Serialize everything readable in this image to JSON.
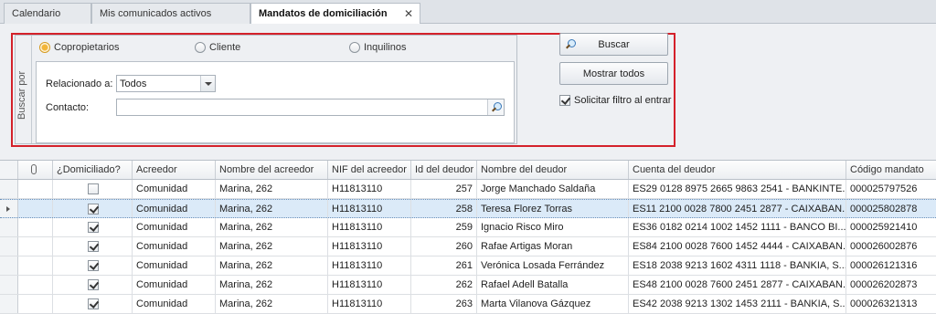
{
  "tabs": [
    {
      "label": "Calendario",
      "active": false
    },
    {
      "label": "Mis comunicados activos",
      "active": false
    },
    {
      "label": "Mandatos de domiciliación",
      "active": true
    }
  ],
  "filter": {
    "group_label": "Buscar por",
    "radios": [
      {
        "label": "Copropietarios",
        "checked": true
      },
      {
        "label": "Cliente",
        "checked": false
      },
      {
        "label": "Inquilinos",
        "checked": false
      }
    ],
    "related_label": "Relacionado a:",
    "related_value": "Todos",
    "contact_label": "Contacto:",
    "contact_value": ""
  },
  "actions": {
    "search_label": "Buscar",
    "show_all_label": "Mostrar todos",
    "filter_on_enter_label": "Solicitar filtro al entrar",
    "filter_on_enter_checked": true
  },
  "grid": {
    "columns": [
      "¿Domiciliado?",
      "Acreedor",
      "Nombre del acreedor",
      "NIF del acreedor",
      "Id del deudor",
      "Nombre del deudor",
      "Cuenta del deudor",
      "Código mandato"
    ],
    "selected_row": 1,
    "rows": [
      {
        "domiciliado": false,
        "acreedor": "Comunidad",
        "nombre_acreedor": "Marina, 262",
        "nif": "H11813110",
        "id_deudor": "257",
        "nombre_deudor": "Jorge Manchado Saldaña",
        "cuenta": "ES29 0128 8975 2665 9863 2541 - BANKINTE...",
        "codigo": "000025797526"
      },
      {
        "domiciliado": true,
        "acreedor": "Comunidad",
        "nombre_acreedor": "Marina, 262",
        "nif": "H11813110",
        "id_deudor": "258",
        "nombre_deudor": "Teresa Florez Torras",
        "cuenta": "ES11 2100 0028 7800 2451 2877 - CAIXABAN...",
        "codigo": "000025802878"
      },
      {
        "domiciliado": true,
        "acreedor": "Comunidad",
        "nombre_acreedor": "Marina, 262",
        "nif": "H11813110",
        "id_deudor": "259",
        "nombre_deudor": "Ignacio Risco Miro",
        "cuenta": "ES36 0182 0214 1002 1452 1111 - BANCO BI...",
        "codigo": "000025921410"
      },
      {
        "domiciliado": true,
        "acreedor": "Comunidad",
        "nombre_acreedor": "Marina, 262",
        "nif": "H11813110",
        "id_deudor": "260",
        "nombre_deudor": "Rafae Artigas Moran",
        "cuenta": "ES84 2100 0028 7600 1452 4444 - CAIXABAN...",
        "codigo": "000026002876"
      },
      {
        "domiciliado": true,
        "acreedor": "Comunidad",
        "nombre_acreedor": "Marina, 262",
        "nif": "H11813110",
        "id_deudor": "261",
        "nombre_deudor": "Verónica Losada Ferrández",
        "cuenta": "ES18 2038 9213 1602 4311 1118 - BANKIA, S...",
        "codigo": "000026121316"
      },
      {
        "domiciliado": true,
        "acreedor": "Comunidad",
        "nombre_acreedor": "Marina, 262",
        "nif": "H11813110",
        "id_deudor": "262",
        "nombre_deudor": "Rafael Adell Batalla",
        "cuenta": "ES48 2100 0028 7600 2451 2877 - CAIXABAN...",
        "codigo": "000026202873"
      },
      {
        "domiciliado": true,
        "acreedor": "Comunidad",
        "nombre_acreedor": "Marina, 262",
        "nif": "H11813110",
        "id_deudor": "263",
        "nombre_deudor": "Marta Vilanova Gázquez",
        "cuenta": "ES42 2038 9213 1302 1453 2111 - BANKIA, S...",
        "codigo": "000026321313"
      }
    ]
  }
}
